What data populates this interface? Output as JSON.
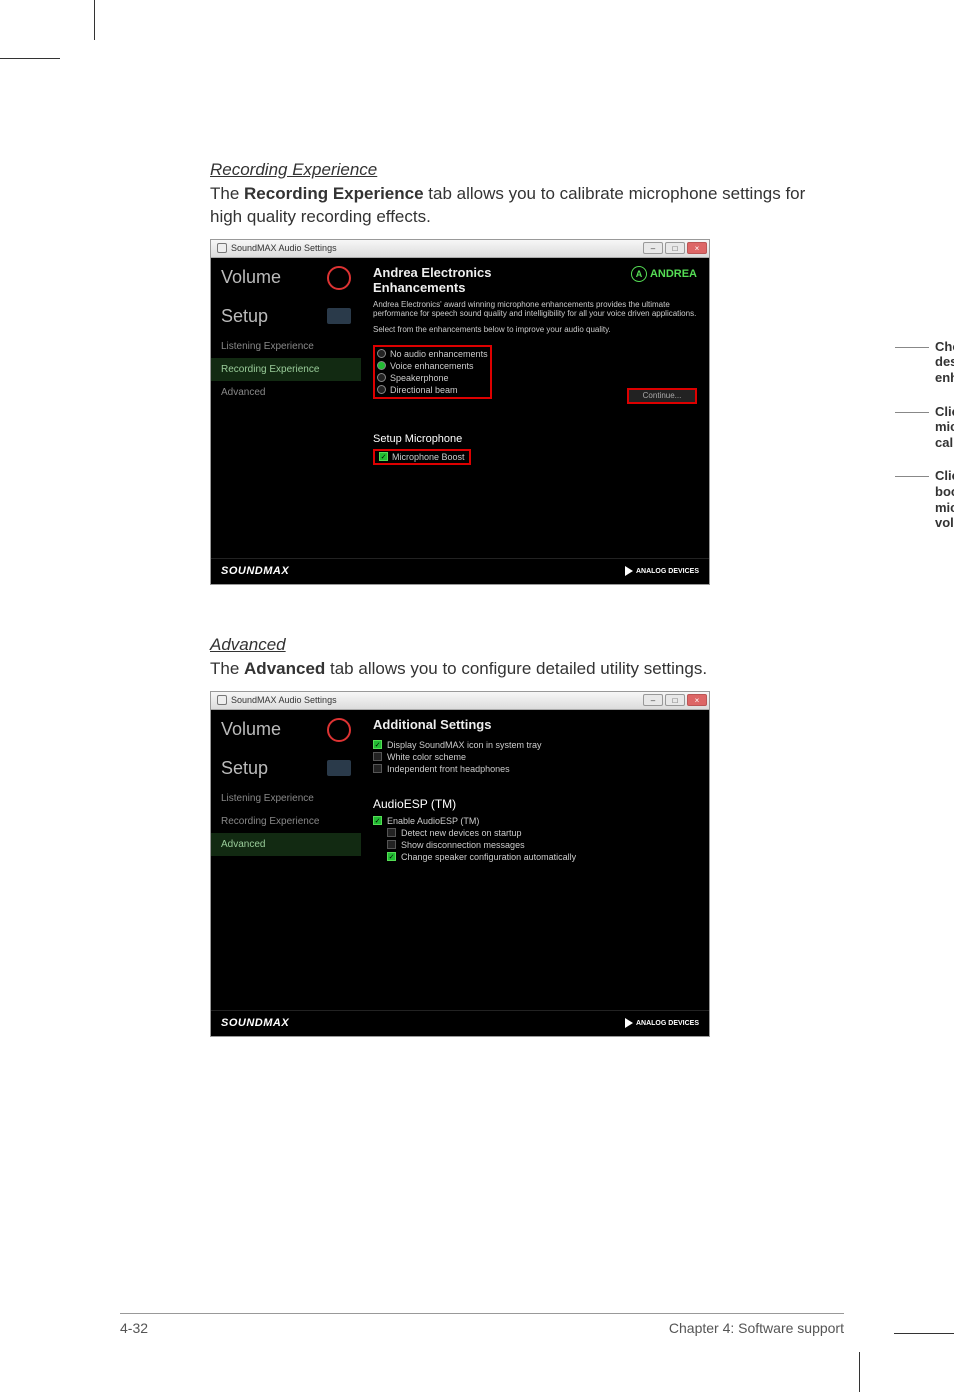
{
  "section1": {
    "heading": "Recording Experience",
    "desc_pre": "The ",
    "desc_bold": "Recording Experience",
    "desc_post": " tab allows you to calibrate microphone settings for high quality recording effects."
  },
  "win1": {
    "title": "SoundMAX Audio Settings",
    "side": {
      "volume": "Volume",
      "setup": "Setup",
      "listening": "Listening Experience",
      "recording": "Recording Experience",
      "advanced": "Advanced"
    },
    "content": {
      "title1": "Andrea Electronics",
      "title2": "Enhancements",
      "logo": "ANDREA",
      "sub1": "Andrea Electronics' award winning microphone enhancements provides the ultimate performance for speech sound quality and intelligibility for all your voice driven applications.",
      "sub2": "Select from the enhancements below to improve your audio quality.",
      "opt_none": "No audio enhancements",
      "opt_voice": "Voice enhancements",
      "opt_speaker": "Speakerphone",
      "opt_beam": "Directional beam",
      "continue": "Continue...",
      "setup_mic": "Setup Microphone",
      "mic_boost": "Microphone Boost"
    },
    "footer": {
      "sound": "SOUNDMAX",
      "analog": "ANALOG\nDEVICES"
    }
  },
  "callouts": {
    "c1": "Choose a desired enhancement",
    "c2": "Click to start microphone calibration",
    "c3": "Click to boost microphone volume"
  },
  "section2": {
    "heading": "Advanced",
    "desc_pre": "The ",
    "desc_bold": "Advanced",
    "desc_post": " tab allows you to configure detailed utility settings."
  },
  "win2": {
    "title": "SoundMAX Audio Settings",
    "side": {
      "volume": "Volume",
      "setup": "Setup",
      "listening": "Listening Experience",
      "recording": "Recording Experience",
      "advanced": "Advanced"
    },
    "content": {
      "title": "Additional Settings",
      "opt_tray": "Display SoundMAX icon in system tray",
      "opt_white": "White color scheme",
      "opt_front": "Independent front headphones",
      "esp_head": "AudioESP (TM)",
      "opt_enable": "Enable AudioESP (TM)",
      "opt_detect": "Detect new devices on startup",
      "opt_show": "Show disconnection messages",
      "opt_change": "Change speaker configuration automatically"
    },
    "footer": {
      "sound": "SOUNDMAX",
      "analog": "ANALOG\nDEVICES"
    }
  },
  "pagefooter": {
    "left": "4-32",
    "right": "Chapter 4: Software support"
  }
}
